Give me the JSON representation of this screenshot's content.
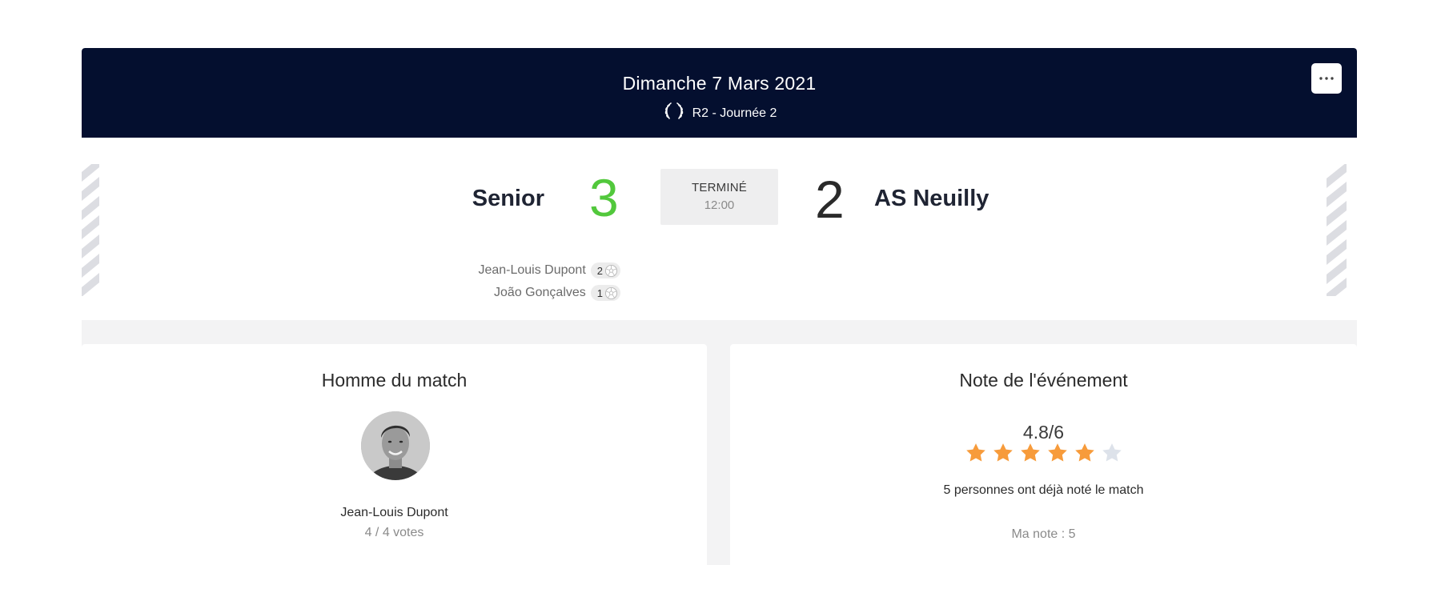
{
  "header": {
    "date": "Dimanche 7 Mars 2021",
    "competition": "R2 - Journée 2",
    "competition_icon": "laurel-icon",
    "more_icon": "more-dots-icon"
  },
  "match": {
    "home_team": "Senior",
    "home_score": "3",
    "away_score": "2",
    "away_team": "AS Neuilly",
    "status": "TERMINÉ",
    "time": "12:00",
    "scorers": [
      {
        "name": "Jean-Louis Dupont",
        "goals": "2"
      },
      {
        "name": "João Gonçalves",
        "goals": "1"
      }
    ],
    "colors": {
      "home_score": "#52c83c",
      "header_bg": "#040f2f"
    }
  },
  "motm": {
    "title": "Homme du match",
    "name": "Jean-Louis Dupont",
    "votes": "4 / 4 votes"
  },
  "rating": {
    "title": "Note de l'événement",
    "value": "4.8/6",
    "stars_filled": 5,
    "stars_total": 6,
    "count_text": "5 personnes ont déjà noté le match",
    "my_rating": "Ma note : 5",
    "colors": {
      "star_on": "#f79b3b",
      "star_off": "#dde2ea"
    }
  }
}
